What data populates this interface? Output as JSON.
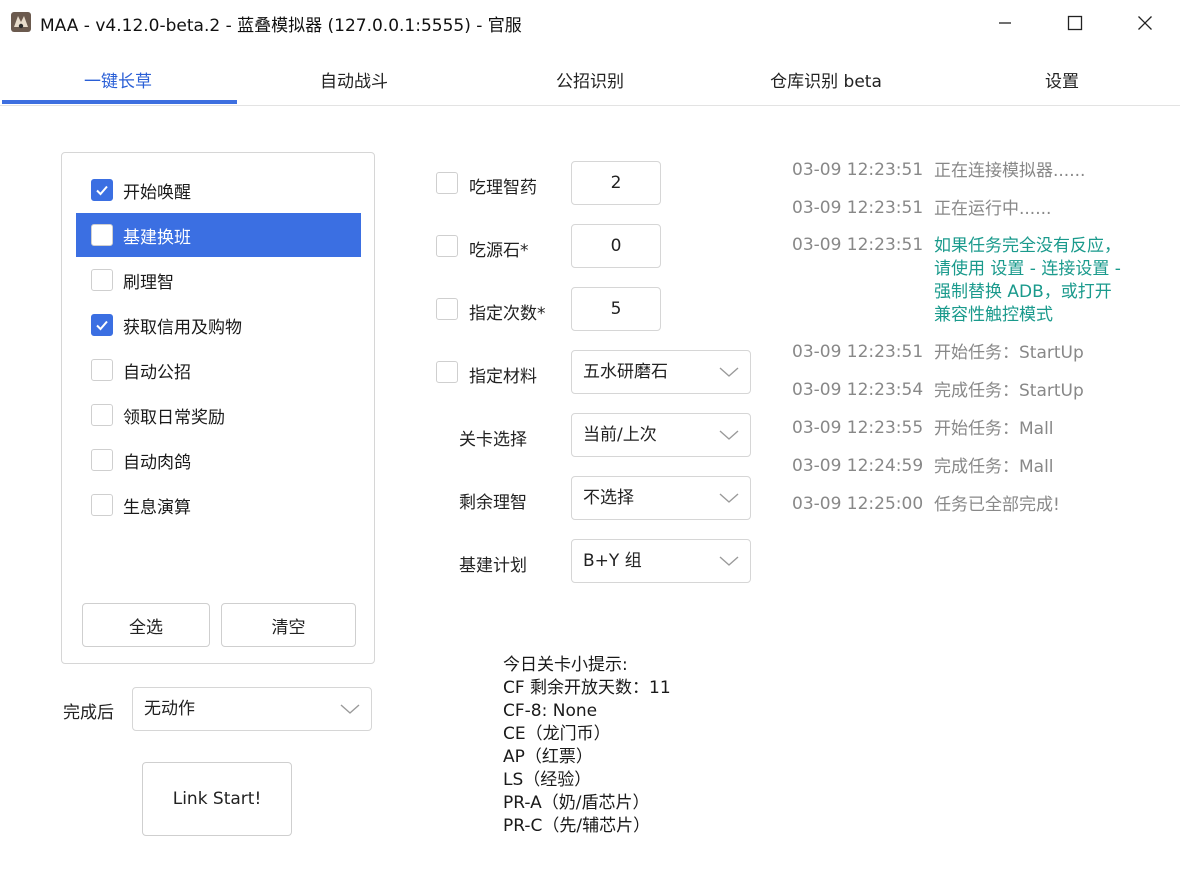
{
  "window": {
    "title": "MAA - v4.12.0-beta.2 - 蓝叠模拟器 (127.0.0.1:5555) - 官服"
  },
  "tabs": [
    {
      "label": "一键长草",
      "active": true
    },
    {
      "label": "自动战斗"
    },
    {
      "label": "公招识别"
    },
    {
      "label": "仓库识别 beta"
    },
    {
      "label": "设置"
    }
  ],
  "tasks": [
    {
      "label": "开始唤醒",
      "checked": true
    },
    {
      "label": "基建换班",
      "checked": false,
      "selected": true
    },
    {
      "label": "刷理智",
      "checked": false
    },
    {
      "label": "获取信用及购物",
      "checked": true
    },
    {
      "label": "自动公招",
      "checked": false
    },
    {
      "label": "领取日常奖励",
      "checked": false
    },
    {
      "label": "自动肉鸽",
      "checked": false
    },
    {
      "label": "生息演算",
      "checked": false
    }
  ],
  "task_buttons": {
    "select_all": "全选",
    "clear": "清空"
  },
  "after_finish": {
    "label": "完成后",
    "value": "无动作"
  },
  "link_start": "Link Start!",
  "options": {
    "medicine": {
      "label": "吃理智药",
      "value": "2"
    },
    "stone": {
      "label": "吃源石*",
      "value": "0"
    },
    "times": {
      "label": "指定次数*",
      "value": "5"
    },
    "material": {
      "label": "指定材料",
      "value": "五水研磨石"
    },
    "stage": {
      "label": "关卡选择",
      "value": "当前/上次"
    },
    "remaining": {
      "label": "剩余理智",
      "value": "不选择"
    },
    "infrast_plan": {
      "label": "基建计划",
      "value": "B+Y 组"
    }
  },
  "tips": [
    "今日关卡小提示:",
    "CF 剩余开放天数：11",
    "CF-8: None",
    "CE（龙门币）",
    "AP（红票）",
    "LS（经验）",
    "PR-A（奶/盾芯片）",
    "PR-C（先/辅芯片）"
  ],
  "log": [
    {
      "time": "03-09  12:23:51",
      "msg": "正在连接模拟器......"
    },
    {
      "time": "03-09  12:23:51",
      "msg": "正在运行中......"
    },
    {
      "time": "03-09  12:23:51",
      "msg": "如果任务完全没有反应，\n请使用 设置 - 连接设置 -\n强制替换 ADB，或打开\n兼容性触控模式",
      "warn": true
    },
    {
      "time": "03-09  12:23:51",
      "msg": "开始任务：StartUp"
    },
    {
      "time": "03-09  12:23:54",
      "msg": "完成任务：StartUp"
    },
    {
      "time": "03-09  12:23:55",
      "msg": "开始任务：Mall"
    },
    {
      "time": "03-09  12:24:59",
      "msg": "完成任务：Mall"
    },
    {
      "time": "03-09  12:25:00",
      "msg": "任务已全部完成!"
    }
  ],
  "colors": {
    "accent": "#3b6fe2",
    "log_warn": "#1a9a8c",
    "log_text": "#888888"
  }
}
